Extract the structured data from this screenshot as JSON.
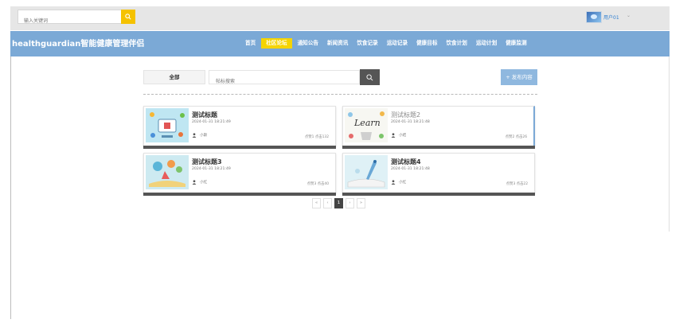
{
  "top": {
    "search_placeholder": "输入关键词",
    "username": "用户01",
    "caret": "⌄"
  },
  "header": {
    "brand": "healthguardian智能健康管理伴侣",
    "nav": [
      {
        "label": "首页",
        "active": false
      },
      {
        "label": "社区论坛",
        "active": true
      },
      {
        "label": "通知公告",
        "active": false
      },
      {
        "label": "新闻资讯",
        "active": false
      },
      {
        "label": "饮食记录",
        "active": false
      },
      {
        "label": "运动记录",
        "active": false
      },
      {
        "label": "健康目标",
        "active": false
      },
      {
        "label": "饮食计划",
        "active": false
      },
      {
        "label": "运动计划",
        "active": false
      },
      {
        "label": "健康监测",
        "active": false
      }
    ]
  },
  "filter": {
    "category": "全部",
    "title_placeholder": "帖标搜索",
    "publish_label": "+ 发布内容"
  },
  "posts": [
    {
      "title": "测试标题",
      "date": "2024-01-31 18:21:49",
      "author": "小斯",
      "stats": "点赞1  点击132"
    },
    {
      "title": "测试标题2",
      "date": "2024-01-31 18:21:48",
      "author": "小结",
      "stats": "点赞2  点击26"
    },
    {
      "title": "测试标题3",
      "date": "2024-01-31 18:21:49",
      "author": "小红",
      "stats": "点赞3  点击40"
    },
    {
      "title": "测试标题4",
      "date": "2024-01-31 18:21:48",
      "author": "小红",
      "stats": "点赞3  点击22"
    }
  ],
  "pagination": {
    "first": "«",
    "prev": "‹",
    "current": "1",
    "next": "›",
    "last": "»"
  },
  "colors": {
    "nav_bg": "#7ba9d6",
    "active_nav": "#f5d400",
    "search_btn": "#f5c200",
    "publish_btn": "#8fb8df"
  }
}
